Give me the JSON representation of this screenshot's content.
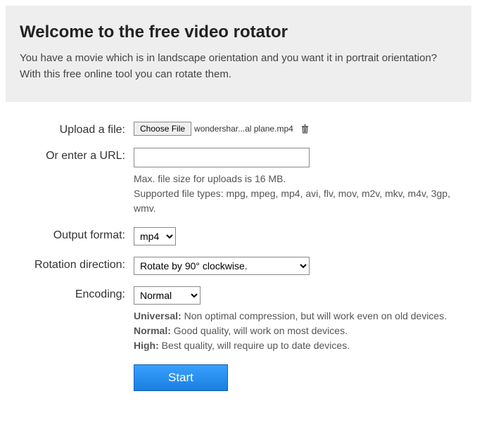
{
  "header": {
    "title": "Welcome to the free video rotator",
    "line1": "You have a movie which is in landscape orientation and you want it in portrait orientation?",
    "line2": "With this free online tool you can rotate them."
  },
  "form": {
    "upload_label": "Upload a file:",
    "choose_file_button": "Choose File",
    "selected_file": "wondershar...al plane.mp4",
    "url_label": "Or enter a URL:",
    "url_value": "",
    "max_size_hint": "Max. file size for uploads is 16 MB.",
    "supported_types_hint": "Supported file types: mpg, mpeg, mp4, avi, flv, mov, m2v, mkv, m4v, 3gp, wmv.",
    "output_format_label": "Output format:",
    "output_format_value": "mp4",
    "rotation_label": "Rotation direction:",
    "rotation_value": "Rotate by 90° clockwise.",
    "encoding_label": "Encoding:",
    "encoding_value": "Normal",
    "encoding_hints": {
      "universal_label": "Universal:",
      "universal_text": " Non optimal compression, but will work even on old devices.",
      "normal_label": "Normal:",
      "normal_text": " Good quality, will work on most devices.",
      "high_label": "High:",
      "high_text": " Best quality, will require up to date devices."
    },
    "start_button": "Start"
  }
}
